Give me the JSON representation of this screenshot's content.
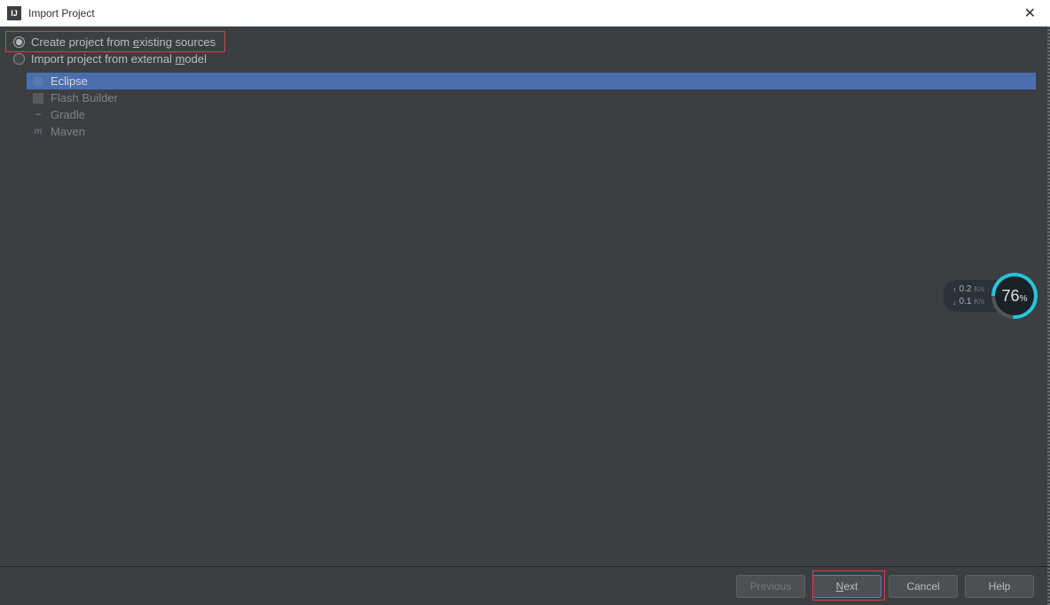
{
  "titlebar": {
    "icon_text": "IJ",
    "title": "Import Project"
  },
  "radios": {
    "existing": {
      "prefix": "Create project from ",
      "mnemonic": "e",
      "suffix": "xisting sources"
    },
    "external": {
      "prefix": "Import project from external ",
      "mnemonic": "m",
      "suffix": "odel"
    }
  },
  "models": {
    "eclipse": "Eclipse",
    "flash": "Flash Builder",
    "gradle": "Gradle",
    "maven": "Maven"
  },
  "buttons": {
    "previous": "Previous",
    "next_mnemonic": "N",
    "next_rest": "ext",
    "cancel": "Cancel",
    "help": "Help"
  },
  "widget": {
    "up_value": "0.2",
    "up_unit": "K/s",
    "down_value": "0.1",
    "down_unit": "K/s",
    "gauge_value": "76",
    "gauge_pct": "%"
  }
}
